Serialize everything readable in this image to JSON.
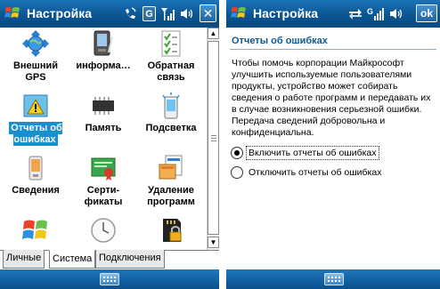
{
  "left_screen": {
    "title": "Настройка",
    "items": [
      {
        "label": "Внешний GPS",
        "icon": "globe-gps-icon"
      },
      {
        "label": "информа…",
        "icon": "pda-info-icon"
      },
      {
        "label": "Обратная связь",
        "icon": "checklist-feedback-icon"
      },
      {
        "label": "Отчеты об ошибках",
        "icon": "error-report-icon",
        "selected": true
      },
      {
        "label": "Память",
        "icon": "memory-chip-icon"
      },
      {
        "label": "Подсветка",
        "icon": "backlight-icon"
      },
      {
        "label": "Сведения",
        "icon": "device-info-icon"
      },
      {
        "label": "Серти-фикаты",
        "icon": "certificate-icon"
      },
      {
        "label": "Удаление программ",
        "icon": "remove-programs-icon"
      },
      {
        "label": "",
        "icon": "windows-logo-icon"
      },
      {
        "label": "",
        "icon": "clock-icon"
      },
      {
        "label": "",
        "icon": "sd-card-lock-icon"
      }
    ],
    "tabs": [
      {
        "label": "Личные",
        "active": false
      },
      {
        "label": "Система",
        "active": true
      },
      {
        "label": "Подключения",
        "active": false
      }
    ],
    "status_icons": {
      "box_label": "G",
      "close_label": "✕"
    }
  },
  "right_screen": {
    "title": "Настройка",
    "heading": "Отчеты об ошибках",
    "description": "Чтобы помочь корпорации Майкрософт улучшить используемые пользователями продукты, устройство может собирать сведения о работе программ и передавать их в случае возникновения серьезной ошибки. Передача сведений добровольна и конфиденциальна.",
    "options": [
      {
        "label": "Включить отчеты об ошибках",
        "selected": true
      },
      {
        "label": "Отключить отчеты об ошибках",
        "selected": false
      }
    ],
    "ok_label": "ok"
  },
  "colors": {
    "title_bar": "#0b5592",
    "selection": "#1a8fd0",
    "heading": "#0a5a9a"
  }
}
